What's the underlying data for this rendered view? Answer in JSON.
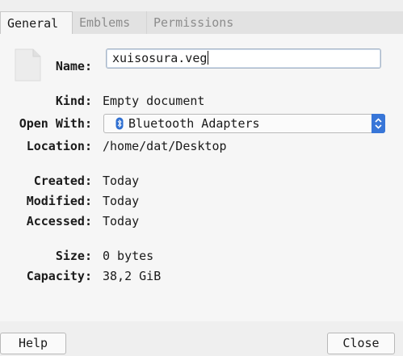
{
  "tabs": [
    {
      "label": "General",
      "active": true
    },
    {
      "label": "Emblems",
      "active": false
    },
    {
      "label": "Permissions",
      "active": false
    }
  ],
  "general": {
    "name_label": "Name:",
    "name_value": "xuisosura.veg",
    "kind_label": "Kind:",
    "kind_value": "Empty document",
    "open_with_label": "Open With:",
    "open_with_value": "Bluetooth Adapters",
    "location_label": "Location:",
    "location_value": "/home/dat/Desktop",
    "created_label": "Created:",
    "created_value": "Today",
    "modified_label": "Modified:",
    "modified_value": "Today",
    "accessed_label": "Accessed:",
    "accessed_value": "Today",
    "size_label": "Size:",
    "size_value": "0 bytes",
    "capacity_label": "Capacity:",
    "capacity_value": "38,2 GiB"
  },
  "buttons": {
    "help": "Help",
    "close": "Close"
  },
  "icons": {
    "file": "empty-document-icon",
    "app": "bluetooth-icon",
    "combo": "up-down-arrows-icon"
  },
  "colors": {
    "accent": "#3876d8",
    "panel": "#f6f6f6",
    "window": "#efefef"
  }
}
